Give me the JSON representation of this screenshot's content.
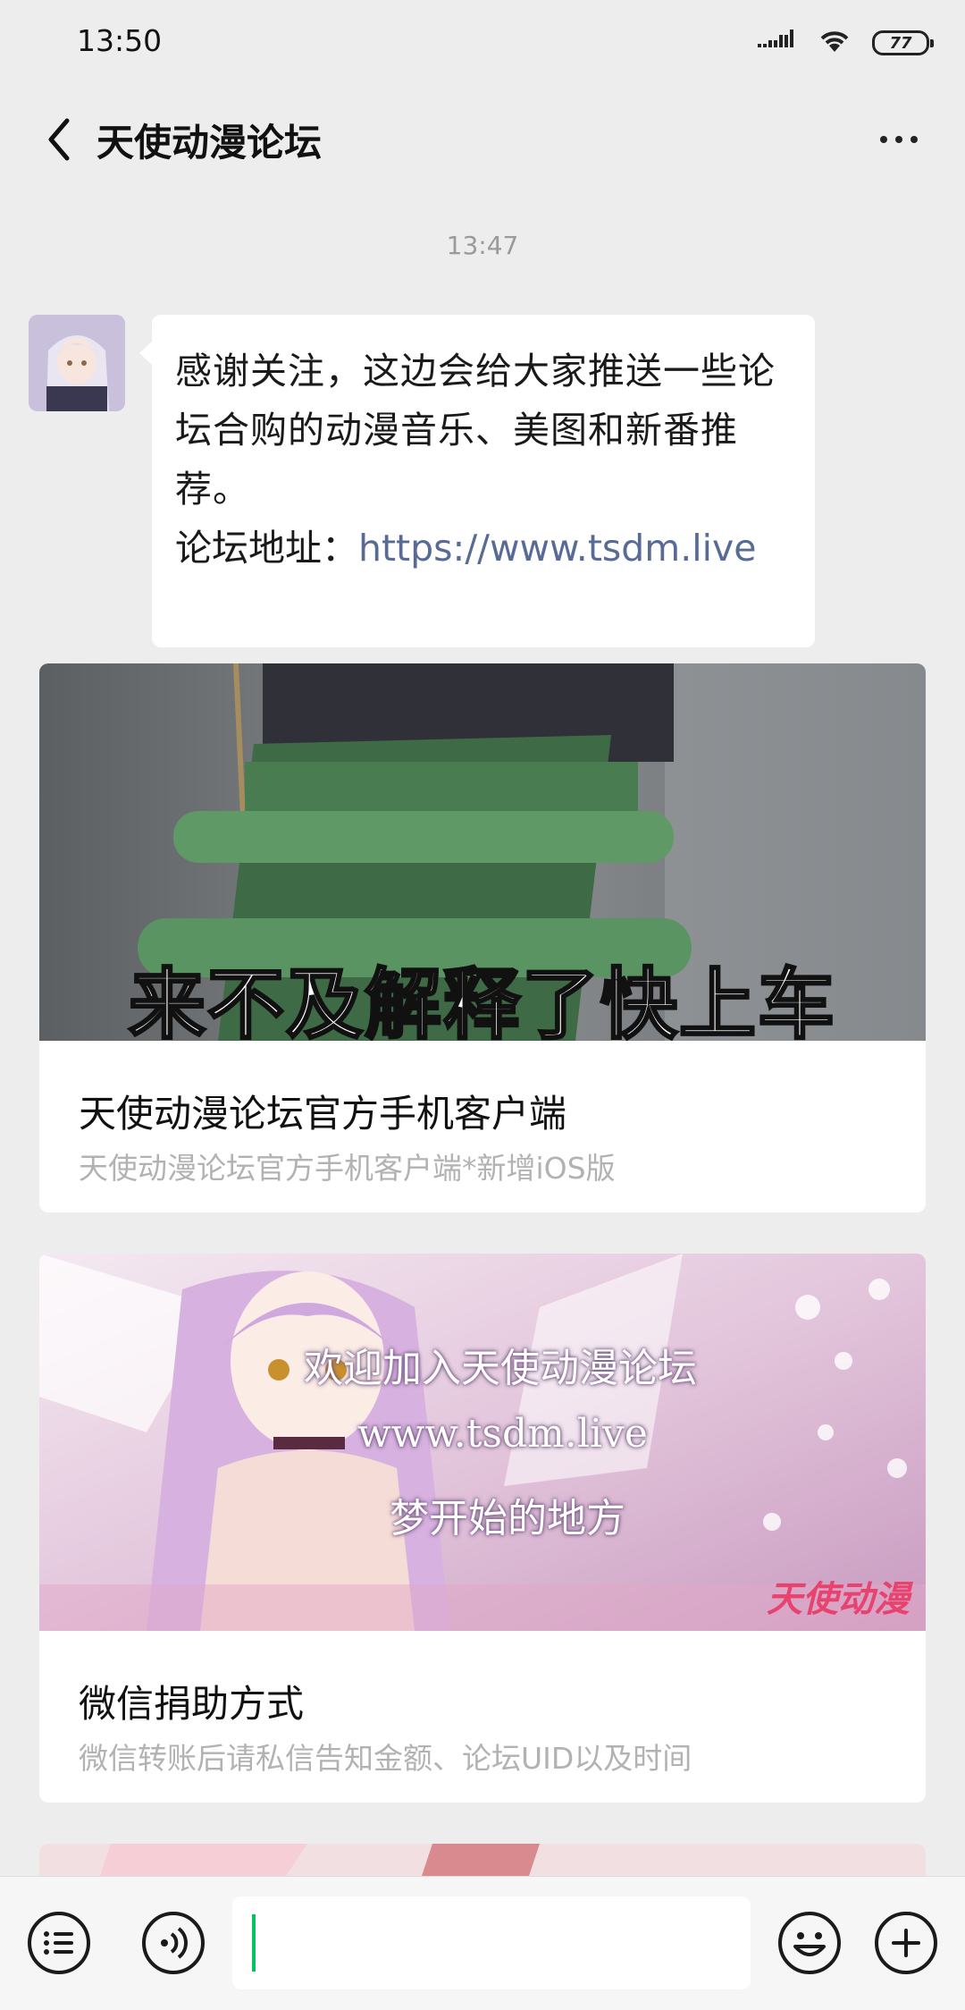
{
  "status_bar": {
    "time": "13:50",
    "battery": "77"
  },
  "nav": {
    "title": "天使动漫论坛"
  },
  "chat": {
    "timestamp": "13:47",
    "welcome": {
      "text": "感谢关注，这边会给大家推送一些论坛合购的动漫音乐、美图和新番推荐。",
      "link_label": "论坛地址：",
      "link_url": "https://www.tsdm.live"
    }
  },
  "articles": [
    {
      "image_caption": "来不及解释了快上车",
      "title": "天使动漫论坛官方手机客户端",
      "description": "天使动漫论坛官方手机客户端*新增iOS版"
    },
    {
      "image_lines": [
        "欢迎加入天使动漫论坛",
        "www.tsdm.live",
        "梦开始的地方"
      ],
      "image_logo": "天使动漫",
      "title": "微信捐助方式",
      "description": "微信转账后请私信告知金额、论坛UID以及时间"
    }
  ],
  "icons": {
    "back": "chevron-left-icon",
    "more": "more-dots-icon",
    "menu": "list-menu-icon",
    "voice": "voice-icon",
    "emoji": "emoji-icon",
    "plus": "plus-icon"
  },
  "colors": {
    "link": "#576b95",
    "cursor": "#07c160",
    "background": "#ededed"
  }
}
